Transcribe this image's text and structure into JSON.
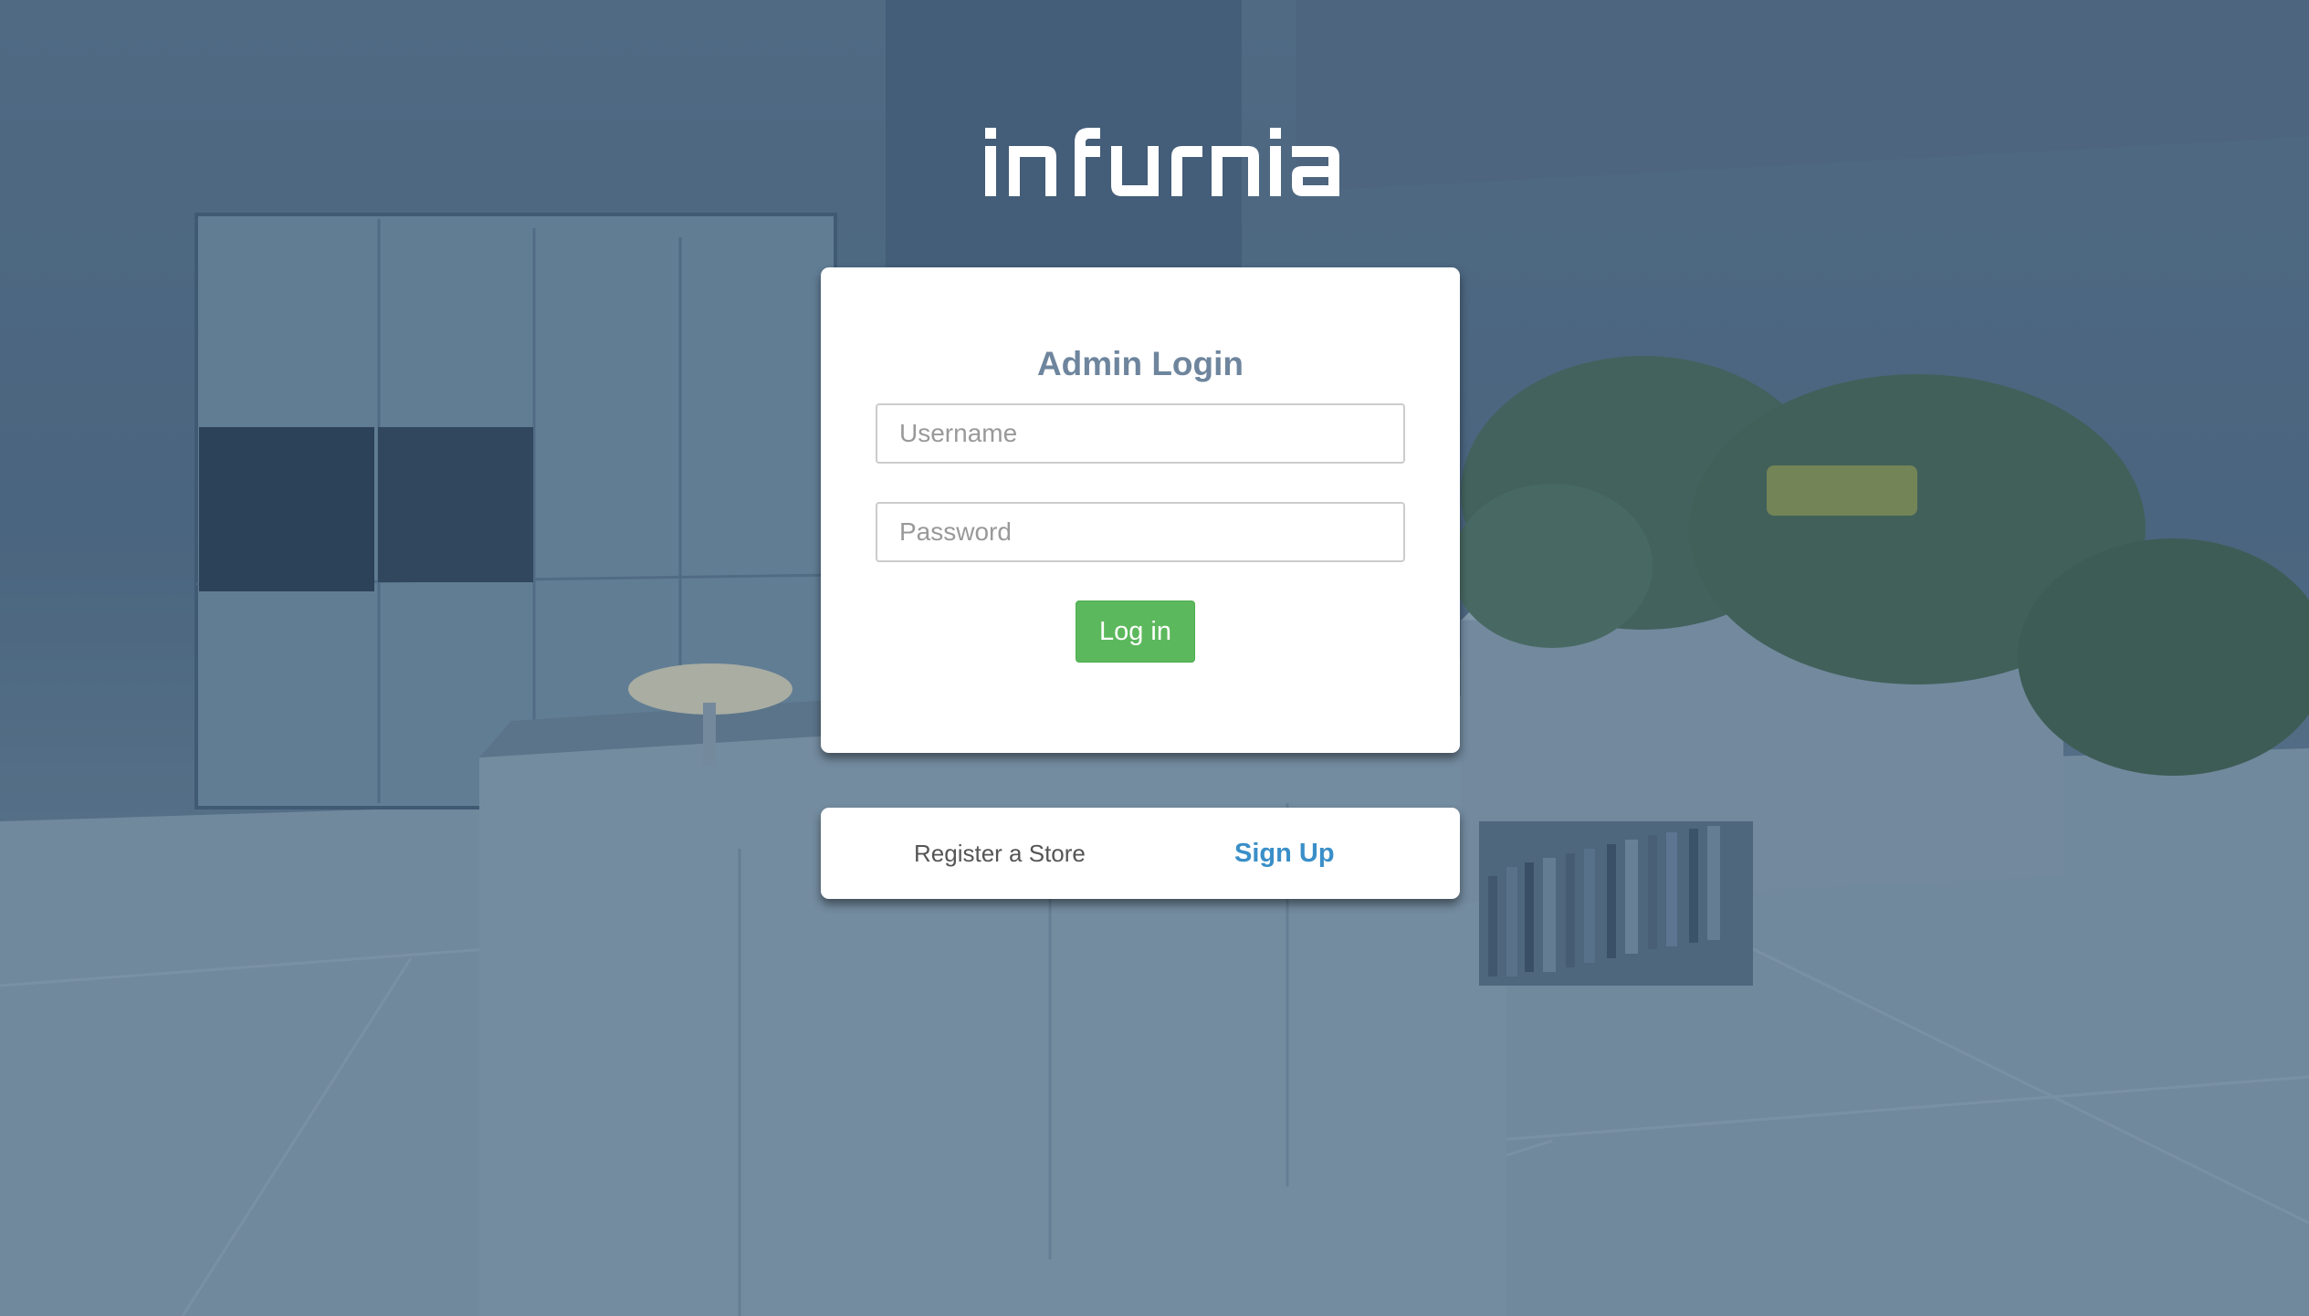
{
  "brand": {
    "logo_text": "infurnia",
    "logo_color": "#ffffff"
  },
  "login_card": {
    "title": "Admin Login",
    "username_placeholder": "Username",
    "password_placeholder": "Password",
    "login_label": "Log in",
    "login_color": "#5cb85c"
  },
  "footer_card": {
    "register_text": "Register a Store",
    "signup_label": "Sign Up",
    "signup_color": "#3a8fc8"
  },
  "colors": {
    "title": "#6e859d",
    "background_tint": "#56708a"
  }
}
